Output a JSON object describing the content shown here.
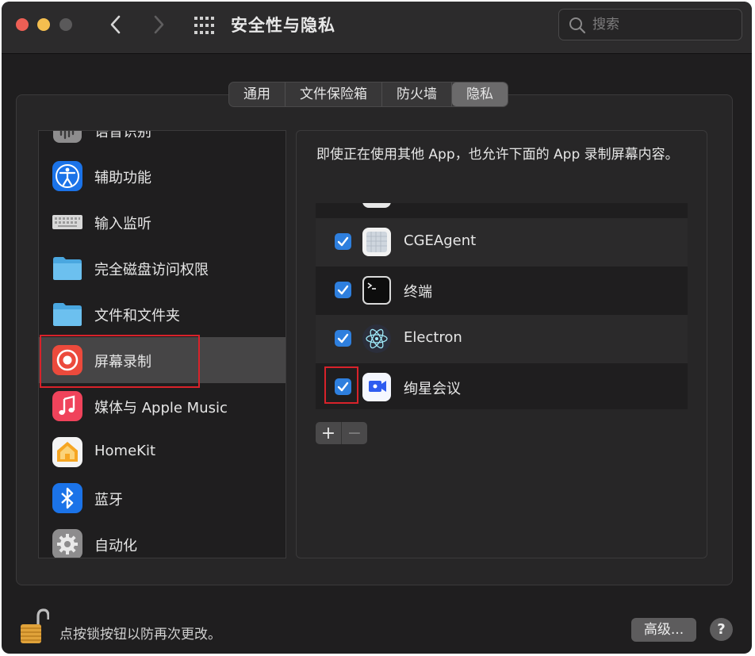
{
  "window": {
    "title": "安全性与隐私"
  },
  "search": {
    "placeholder": "搜索"
  },
  "tabs": [
    {
      "label": "通用",
      "active": false
    },
    {
      "label": "文件保险箱",
      "active": false
    },
    {
      "label": "防火墙",
      "active": false
    },
    {
      "label": "隐私",
      "active": true
    }
  ],
  "sidebar": {
    "items": [
      {
        "label": "语音识别",
        "icon": "microphone-icon"
      },
      {
        "label": "辅助功能",
        "icon": "accessibility-icon"
      },
      {
        "label": "输入监听",
        "icon": "keyboard-icon"
      },
      {
        "label": "完全磁盘访问权限",
        "icon": "folder-icon"
      },
      {
        "label": "文件和文件夹",
        "icon": "folder-icon"
      },
      {
        "label": "屏幕录制",
        "icon": "screen-recording-icon",
        "selected": true
      },
      {
        "label": "媒体与 Apple Music",
        "icon": "music-icon"
      },
      {
        "label": "HomeKit",
        "icon": "home-icon"
      },
      {
        "label": "蓝牙",
        "icon": "bluetooth-icon"
      },
      {
        "label": "自动化",
        "icon": "gear-icon"
      }
    ]
  },
  "detail": {
    "description": "即使正在使用其他 App，也允许下面的 App 录制屏幕内容。",
    "apps": [
      {
        "name": "CGEAgent",
        "checked": true,
        "icon": "cgeagent-icon"
      },
      {
        "name": "终端",
        "checked": true,
        "icon": "terminal-icon"
      },
      {
        "name": "Electron",
        "checked": true,
        "icon": "electron-icon"
      },
      {
        "name": "绚星会议",
        "checked": true,
        "icon": "meeting-app-icon"
      }
    ],
    "add_label": "+",
    "remove_label": "−"
  },
  "footer": {
    "lock_text": "点按锁按钮以防再次更改。",
    "advanced_label": "高级...",
    "help_label": "?"
  },
  "colors": {
    "window_bg": "#1f1e1f",
    "accent": "#2e7fde",
    "highlight_red": "#d8222a"
  }
}
